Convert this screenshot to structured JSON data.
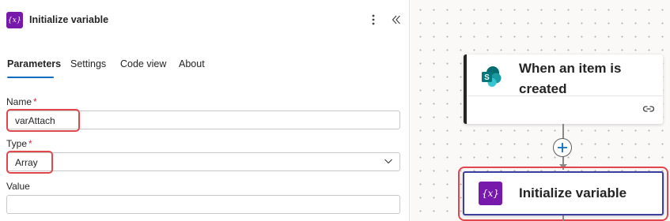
{
  "panel": {
    "icon": "variable-icon",
    "icon_text": "{x}",
    "title": "Initialize variable",
    "more_icon": "more-vertical-icon",
    "collapse_icon": "double-chevron-left-icon",
    "tabs": [
      {
        "label": "Parameters",
        "active": true
      },
      {
        "label": "Settings",
        "active": false
      },
      {
        "label": "Code view",
        "active": false
      },
      {
        "label": "About",
        "active": false
      }
    ],
    "fields": {
      "name": {
        "label": "Name",
        "required_marker": "*",
        "value": "varAttach"
      },
      "type": {
        "label": "Type",
        "required_marker": "*",
        "value": "Array"
      },
      "value": {
        "label": "Value",
        "value": ""
      }
    }
  },
  "canvas": {
    "trigger": {
      "title": "When an item is created",
      "icon": "sharepoint-icon",
      "footer_icon": "link-icon"
    },
    "add_step_icon": "plus-icon",
    "action": {
      "title": "Initialize variable",
      "icon": "variable-icon",
      "icon_text": "{x}"
    }
  },
  "colors": {
    "accent": "#0f6cbd",
    "variable_purple": "#7719aa",
    "highlight_red": "#e0474c",
    "selected_border": "#3b3ea3",
    "required_red": "#c4314b"
  }
}
